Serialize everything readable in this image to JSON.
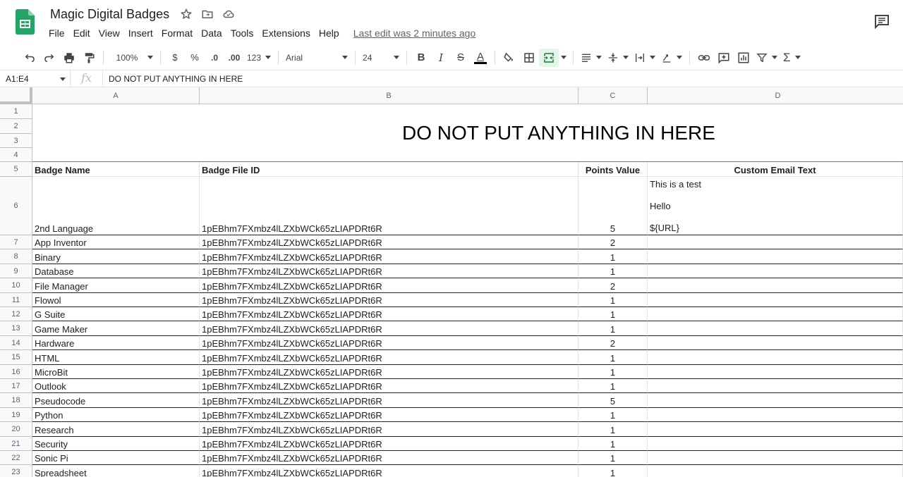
{
  "app": {
    "doc_title": "Magic Digital Badges",
    "icons": {
      "logo": "sheets-logo-icon",
      "star": "star-icon",
      "move": "folder-move-icon",
      "cloud": "cloud-status-icon",
      "comments": "comments-icon"
    }
  },
  "menu": {
    "items": [
      "File",
      "Edit",
      "View",
      "Insert",
      "Format",
      "Data",
      "Tools",
      "Extensions",
      "Help"
    ],
    "last_edit": "Last edit was 2 minutes ago"
  },
  "toolbar": {
    "zoom": "100%",
    "currency": "$",
    "percent": "%",
    "dec_decrease": ".0",
    "dec_increase": ".00",
    "more_formats": "123",
    "font": "Arial",
    "font_size": "24",
    "bold": "B",
    "italic": "I",
    "strike": "S",
    "text_color": "A",
    "colors": {
      "text_color_bar": "#000000",
      "merge_active": "#e6f4ea"
    }
  },
  "formula_bar": {
    "name_box": "A1:E4",
    "fx": "fx",
    "content": "DO NOT PUT ANYTHING IN HERE"
  },
  "columns": [
    "A",
    "B",
    "C",
    "D"
  ],
  "merged_title": "DO NOT PUT ANYTHING IN HERE",
  "header_row": {
    "num": "5",
    "badge_name": "Badge Name",
    "badge_file_id": "Badge File ID",
    "points_value": "Points Value",
    "custom_email_text": "Custom Email Text"
  },
  "title_rows": [
    "1",
    "2",
    "3",
    "4"
  ],
  "row6": {
    "num": "6",
    "badge_name": "2nd Language",
    "badge_file_id": "1pEBhm7FXmbz4lLZXbWCk65zLIAPDRt6R",
    "points": "5",
    "email_lines": [
      "This is a test",
      "Hello",
      "${URL}"
    ]
  },
  "rows": [
    {
      "num": "7",
      "name": "App Inventor",
      "file_id": "1pEBhm7FXmbz4lLZXbWCk65zLIAPDRt6R",
      "points": "2"
    },
    {
      "num": "8",
      "name": "Binary",
      "file_id": "1pEBhm7FXmbz4lLZXbWCk65zLIAPDRt6R",
      "points": "1"
    },
    {
      "num": "9",
      "name": "Database",
      "file_id": "1pEBhm7FXmbz4lLZXbWCk65zLIAPDRt6R",
      "points": "1"
    },
    {
      "num": "10",
      "name": "File Manager",
      "file_id": "1pEBhm7FXmbz4lLZXbWCk65zLIAPDRt6R",
      "points": "2"
    },
    {
      "num": "11",
      "name": "Flowol",
      "file_id": "1pEBhm7FXmbz4lLZXbWCk65zLIAPDRt6R",
      "points": "1"
    },
    {
      "num": "12",
      "name": "G Suite",
      "file_id": "1pEBhm7FXmbz4lLZXbWCk65zLIAPDRt6R",
      "points": "1"
    },
    {
      "num": "13",
      "name": "Game Maker",
      "file_id": "1pEBhm7FXmbz4lLZXbWCk65zLIAPDRt6R",
      "points": "1"
    },
    {
      "num": "14",
      "name": "Hardware",
      "file_id": "1pEBhm7FXmbz4lLZXbWCk65zLIAPDRt6R",
      "points": "2"
    },
    {
      "num": "15",
      "name": "HTML",
      "file_id": "1pEBhm7FXmbz4lLZXbWCk65zLIAPDRt6R",
      "points": "1"
    },
    {
      "num": "16",
      "name": "MicroBit",
      "file_id": "1pEBhm7FXmbz4lLZXbWCk65zLIAPDRt6R",
      "points": "1"
    },
    {
      "num": "17",
      "name": "Outlook",
      "file_id": "1pEBhm7FXmbz4lLZXbWCk65zLIAPDRt6R",
      "points": "1"
    },
    {
      "num": "18",
      "name": "Pseudocode",
      "file_id": "1pEBhm7FXmbz4lLZXbWCk65zLIAPDRt6R",
      "points": "5"
    },
    {
      "num": "19",
      "name": "Python",
      "file_id": "1pEBhm7FXmbz4lLZXbWCk65zLIAPDRt6R",
      "points": "1"
    },
    {
      "num": "20",
      "name": "Research",
      "file_id": "1pEBhm7FXmbz4lLZXbWCk65zLIAPDRt6R",
      "points": "1"
    },
    {
      "num": "21",
      "name": "Security",
      "file_id": "1pEBhm7FXmbz4lLZXbWCk65zLIAPDRt6R",
      "points": "1"
    },
    {
      "num": "22",
      "name": "Sonic Pi",
      "file_id": "1pEBhm7FXmbz4lLZXbWCk65zLIAPDRt6R",
      "points": "1"
    },
    {
      "num": "23",
      "name": "Spreadsheet",
      "file_id": "1pEBhm7FXmbz4lLZXbWCk65zLIAPDRt6R",
      "points": "1"
    }
  ]
}
